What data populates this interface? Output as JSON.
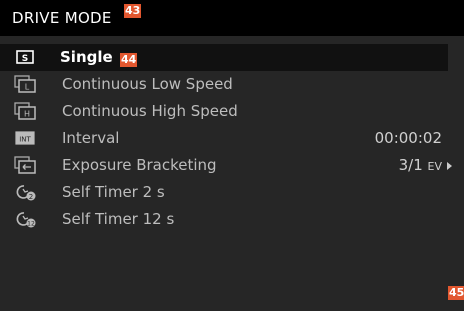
{
  "header": {
    "title": "DRIVE MODE",
    "badge": "43"
  },
  "items": [
    {
      "label": "Single",
      "badge": "44",
      "icon": "single-frame-icon"
    },
    {
      "label": "Continuous Low Speed",
      "icon": "continuous-low-icon"
    },
    {
      "label": "Continuous High Speed",
      "icon": "continuous-high-icon"
    },
    {
      "label": "Interval",
      "value": "00:00:02",
      "badge": "45",
      "icon": "interval-icon"
    },
    {
      "label": "Exposure Bracketing",
      "value": "3/1",
      "value_unit": "EV",
      "icon": "bracketing-icon"
    },
    {
      "label": "Self Timer 2 s",
      "icon": "self-timer-2-icon"
    },
    {
      "label": "Self Timer 12 s",
      "icon": "self-timer-12-icon"
    }
  ],
  "colors": {
    "background": "#262626",
    "header": "#000000",
    "selected_row": "#111111",
    "badge": "#e2572f"
  }
}
